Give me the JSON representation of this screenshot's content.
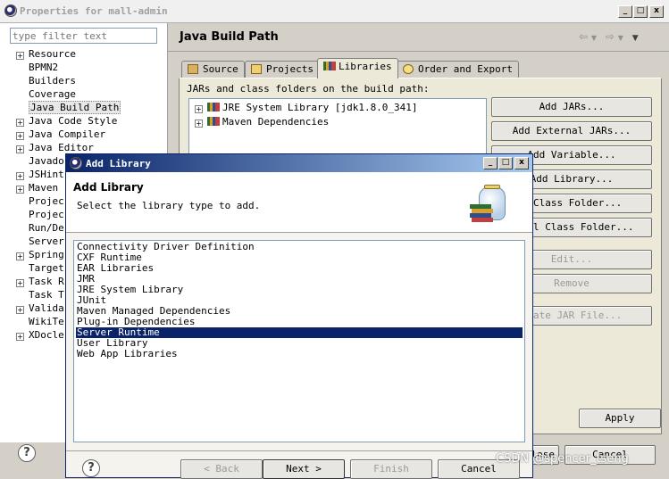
{
  "window": {
    "title": "Properties for mall-admin",
    "min": "_",
    "max": "□",
    "close": "x"
  },
  "filter": {
    "placeholder": "type filter text"
  },
  "tree": [
    {
      "label": "Resource",
      "expandable": true
    },
    {
      "label": "BPMN2",
      "expandable": false
    },
    {
      "label": "Builders",
      "expandable": false
    },
    {
      "label": "Coverage",
      "expandable": false
    },
    {
      "label": "Java Build Path",
      "expandable": false,
      "selected": true
    },
    {
      "label": "Java Code Style",
      "expandable": true
    },
    {
      "label": "Java Compiler",
      "expandable": true
    },
    {
      "label": "Java Editor",
      "expandable": true
    },
    {
      "label": "Javado",
      "expandable": false
    },
    {
      "label": "JSHint",
      "expandable": true
    },
    {
      "label": "Maven",
      "expandable": true
    },
    {
      "label": "Projec",
      "expandable": false
    },
    {
      "label": "Projec",
      "expandable": false
    },
    {
      "label": "Run/De",
      "expandable": false
    },
    {
      "label": "Server",
      "expandable": false
    },
    {
      "label": "Spring",
      "expandable": true
    },
    {
      "label": "Target",
      "expandable": false
    },
    {
      "label": "Task R",
      "expandable": true
    },
    {
      "label": "Task T",
      "expandable": false
    },
    {
      "label": "Valida",
      "expandable": true
    },
    {
      "label": "WikiTe",
      "expandable": false
    },
    {
      "label": "XDocle",
      "expandable": true
    }
  ],
  "page": {
    "title": "Java Build Path"
  },
  "tabs": [
    {
      "label": "Source"
    },
    {
      "label": "Projects"
    },
    {
      "label": "Libraries",
      "active": true
    },
    {
      "label": "Order and Export"
    }
  ],
  "jars_label": "JARs and class folders on the build path:",
  "libs": [
    {
      "label": "JRE System Library [jdk1.8.0_341]"
    },
    {
      "label": "Maven Dependencies"
    }
  ],
  "side_buttons": [
    {
      "label": "Add JARs..."
    },
    {
      "label": "Add External JARs..."
    },
    {
      "label": "Add Variable..."
    },
    {
      "label": "Add Library..."
    },
    {
      "label": "d Class Folder..."
    },
    {
      "label": "ernal Class Folder..."
    },
    {
      "label": "Edit...",
      "disabled": true
    },
    {
      "label": "Remove",
      "disabled": true
    },
    {
      "label": "grate JAR File...",
      "disabled": true
    }
  ],
  "apply_label": "Apply",
  "bottom": {
    "close_label": "lose",
    "cancel_label": "Cancel"
  },
  "dialog": {
    "title": "Add Library",
    "header": "Add Library",
    "description": "Select the library type to add.",
    "items": [
      "Connectivity Driver Definition",
      "CXF Runtime",
      "EAR Libraries",
      "JMR",
      "JRE System Library",
      "JUnit",
      "Maven Managed Dependencies",
      "Plug-in Dependencies",
      "Server Runtime",
      "User Library",
      "Web App Libraries"
    ],
    "selected_index": 8,
    "back_label": "< Back",
    "next_label": "Next >",
    "finish_label": "Finish",
    "cancel_label": "Cancel"
  },
  "watermark": "CSDN @spencer_tseng",
  "help_symbol": "?"
}
